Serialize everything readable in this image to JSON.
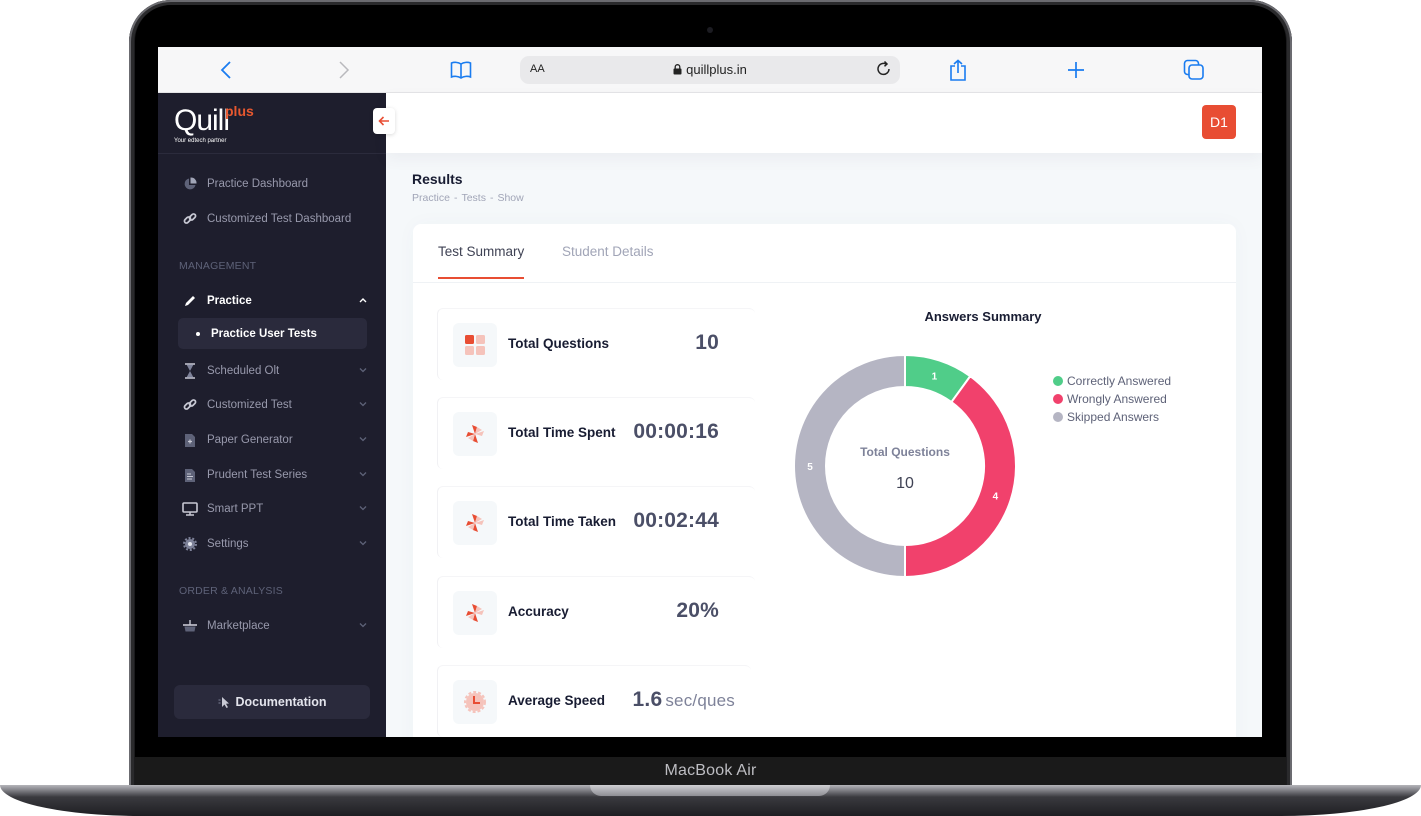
{
  "device": {
    "label": "MacBook Air"
  },
  "browser": {
    "url": "quillplus.in",
    "text_size_label": "AA",
    "icons": [
      "back-icon",
      "forward-icon",
      "bookmarks-icon",
      "lock-icon",
      "reload-icon",
      "share-icon",
      "new-tab-icon",
      "tabs-icon"
    ]
  },
  "brand": {
    "name": "Quill",
    "superscript": "plus",
    "tagline": "Your edtech partner",
    "accent": "#e84d33"
  },
  "sidebar": {
    "top_items": [
      {
        "label": "Practice Dashboard",
        "icon": "pie-chart-icon"
      },
      {
        "label": "Customized Test Dashboard",
        "icon": "link-icon"
      }
    ],
    "sections": [
      {
        "title": "MANAGEMENT",
        "items": [
          {
            "label": "Practice",
            "icon": "pencil-icon",
            "expanded": true,
            "active": true,
            "children": [
              {
                "label": "Practice User Tests",
                "active": true
              }
            ]
          },
          {
            "label": "Scheduled Olt",
            "icon": "hourglass-icon"
          },
          {
            "label": "Customized Test",
            "icon": "link-icon"
          },
          {
            "label": "Paper Generator",
            "icon": "document-plus-icon"
          },
          {
            "label": "Prudent Test Series",
            "icon": "document-icon"
          },
          {
            "label": "Smart PPT",
            "icon": "monitor-icon"
          },
          {
            "label": "Settings",
            "icon": "gear-icon"
          }
        ]
      },
      {
        "title": "ORDER & ANALYSIS",
        "items": [
          {
            "label": "Marketplace",
            "icon": "basket-icon"
          }
        ]
      }
    ],
    "documentation_label": "Documentation"
  },
  "header": {
    "avatar_initials": "D1"
  },
  "page": {
    "title": "Results",
    "breadcrumb": [
      "Practice",
      "Tests",
      "Show"
    ],
    "breadcrumb_separator": "-"
  },
  "tabs": [
    {
      "label": "Test Summary",
      "active": true
    },
    {
      "label": "Student Details",
      "active": false
    }
  ],
  "stats": [
    {
      "label": "Total Questions",
      "value": "10",
      "unit": "",
      "icon": "grid-icon"
    },
    {
      "label": "Total Time Spent",
      "value": "00:00:16",
      "unit": "",
      "icon": "pinwheel-icon"
    },
    {
      "label": "Total Time Taken",
      "value": "00:02:44",
      "unit": "",
      "icon": "pinwheel-icon"
    },
    {
      "label": "Accuracy",
      "value": "20%",
      "unit": "",
      "icon": "pinwheel-icon"
    },
    {
      "label": "Average Speed",
      "value": "1.6",
      "unit": "sec/ques",
      "icon": "clock-icon"
    }
  ],
  "chart_data": {
    "type": "pie",
    "variant": "donut",
    "title": "Answers Summary",
    "center_label": "Total Questions",
    "center_value": "10",
    "categories": [
      "Correctly Answered",
      "Wrongly Answered",
      "Skipped Answers"
    ],
    "values": [
      1,
      4,
      5
    ],
    "colors": [
      "#50cd89",
      "#f1416c",
      "#b5b5c3"
    ],
    "legend_position": "right"
  }
}
